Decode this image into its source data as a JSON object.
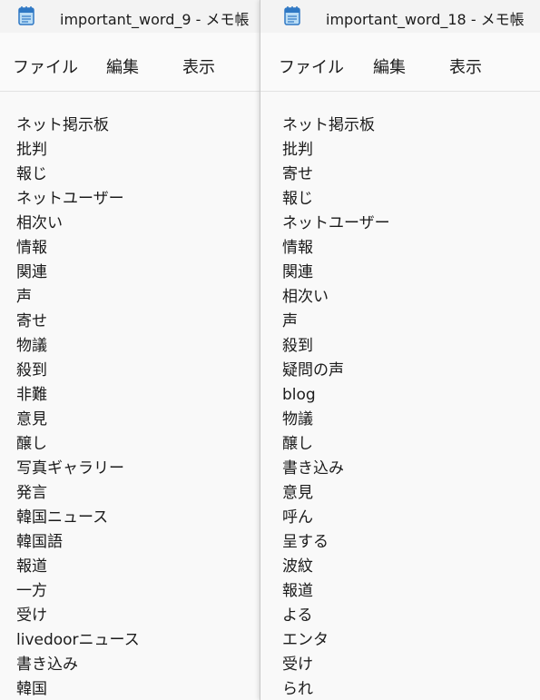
{
  "windows": [
    {
      "title": "important_word_9 - メモ帳",
      "menu": [
        "ファイル",
        "編集",
        "表示"
      ],
      "lines": [
        "ネット掲示板",
        "批判",
        "報じ",
        "ネットユーザー",
        "相次い",
        "情報",
        "関連",
        "声",
        "寄せ",
        "物議",
        "殺到",
        "非難",
        "意見",
        "醸し",
        "写真ギャラリー",
        "発言",
        "韓国ニュース",
        "韓国語",
        "報道",
        "一方",
        "受け",
        "livedoorニュース",
        "書き込み",
        "韓国"
      ]
    },
    {
      "title": "important_word_18 - メモ帳",
      "menu": [
        "ファイル",
        "編集",
        "表示"
      ],
      "lines": [
        "ネット掲示板",
        "批判",
        "寄せ",
        "報じ",
        "ネットユーザー",
        "情報",
        "関連",
        "相次い",
        "声",
        "殺到",
        "疑問の声",
        "blog",
        "物議",
        "醸し",
        "書き込み",
        "意見",
        "呼ん",
        "呈する",
        "波紋",
        "報道",
        "よる",
        "エンタ",
        "受け",
        "られ"
      ]
    }
  ],
  "icons": {
    "app": "notepad-icon"
  },
  "colors": {
    "icon_blue": "#2f78c4",
    "icon_light": "#b9dcf5",
    "text": "#1b1b1b"
  }
}
